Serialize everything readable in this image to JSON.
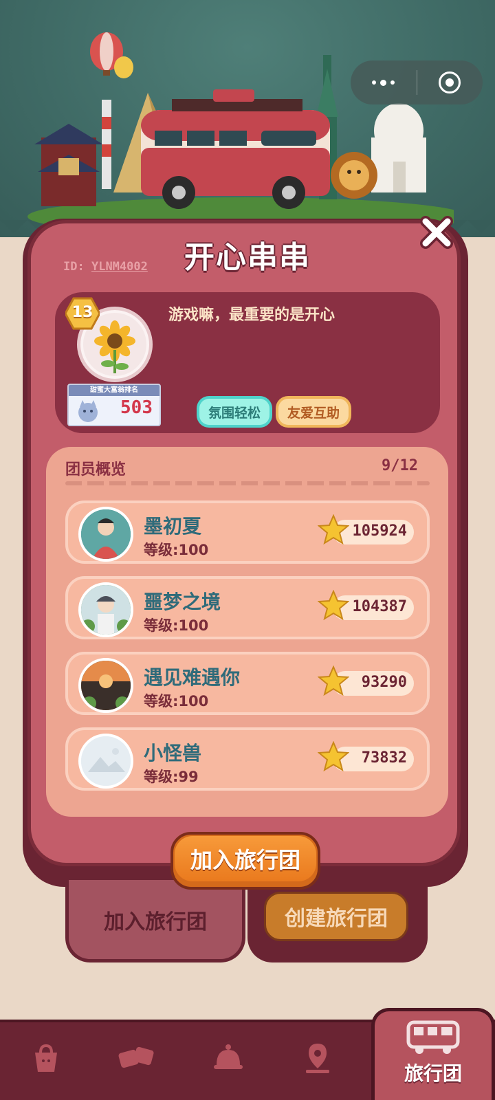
{
  "header": {
    "title": "开心串串",
    "id_prefix": "ID:",
    "id_value": "YLNM4002",
    "close_icon": "close-icon"
  },
  "capsule": {
    "more_icon": "more-dots-icon",
    "exit_icon": "target-icon"
  },
  "profile": {
    "level": "13",
    "motto": "游戏嘛，最重要的是开心",
    "rank_title": "甜蜜大富翁排名",
    "rank_value": "503",
    "tags": [
      "氛围轻松",
      "友爱互助"
    ]
  },
  "members": {
    "header": "团员概览",
    "count": "9/12",
    "items": [
      {
        "name": "墨初夏",
        "level": "等级:100",
        "score": "105924"
      },
      {
        "name": "噩梦之境",
        "level": "等级:100",
        "score": "104387"
      },
      {
        "name": "遇见难遇你",
        "level": "等级:100",
        "score": "93290"
      },
      {
        "name": "小怪兽",
        "level": "等级:99",
        "score": "73832"
      }
    ]
  },
  "actions": {
    "join_main": "加入旅行团",
    "tab_join": "加入旅行团",
    "tab_create": "创建旅行团"
  },
  "navbar": {
    "items": [
      "bag-icon",
      "cards-icon",
      "bell-icon",
      "map-icon"
    ],
    "active_label": "旅行团",
    "active_icon": "bus-icon"
  },
  "colors": {
    "panel": "#c35d6a",
    "panel_border": "#7b2c3a",
    "accent_orange": "#f0882a",
    "member_name": "#2f6b7a"
  }
}
